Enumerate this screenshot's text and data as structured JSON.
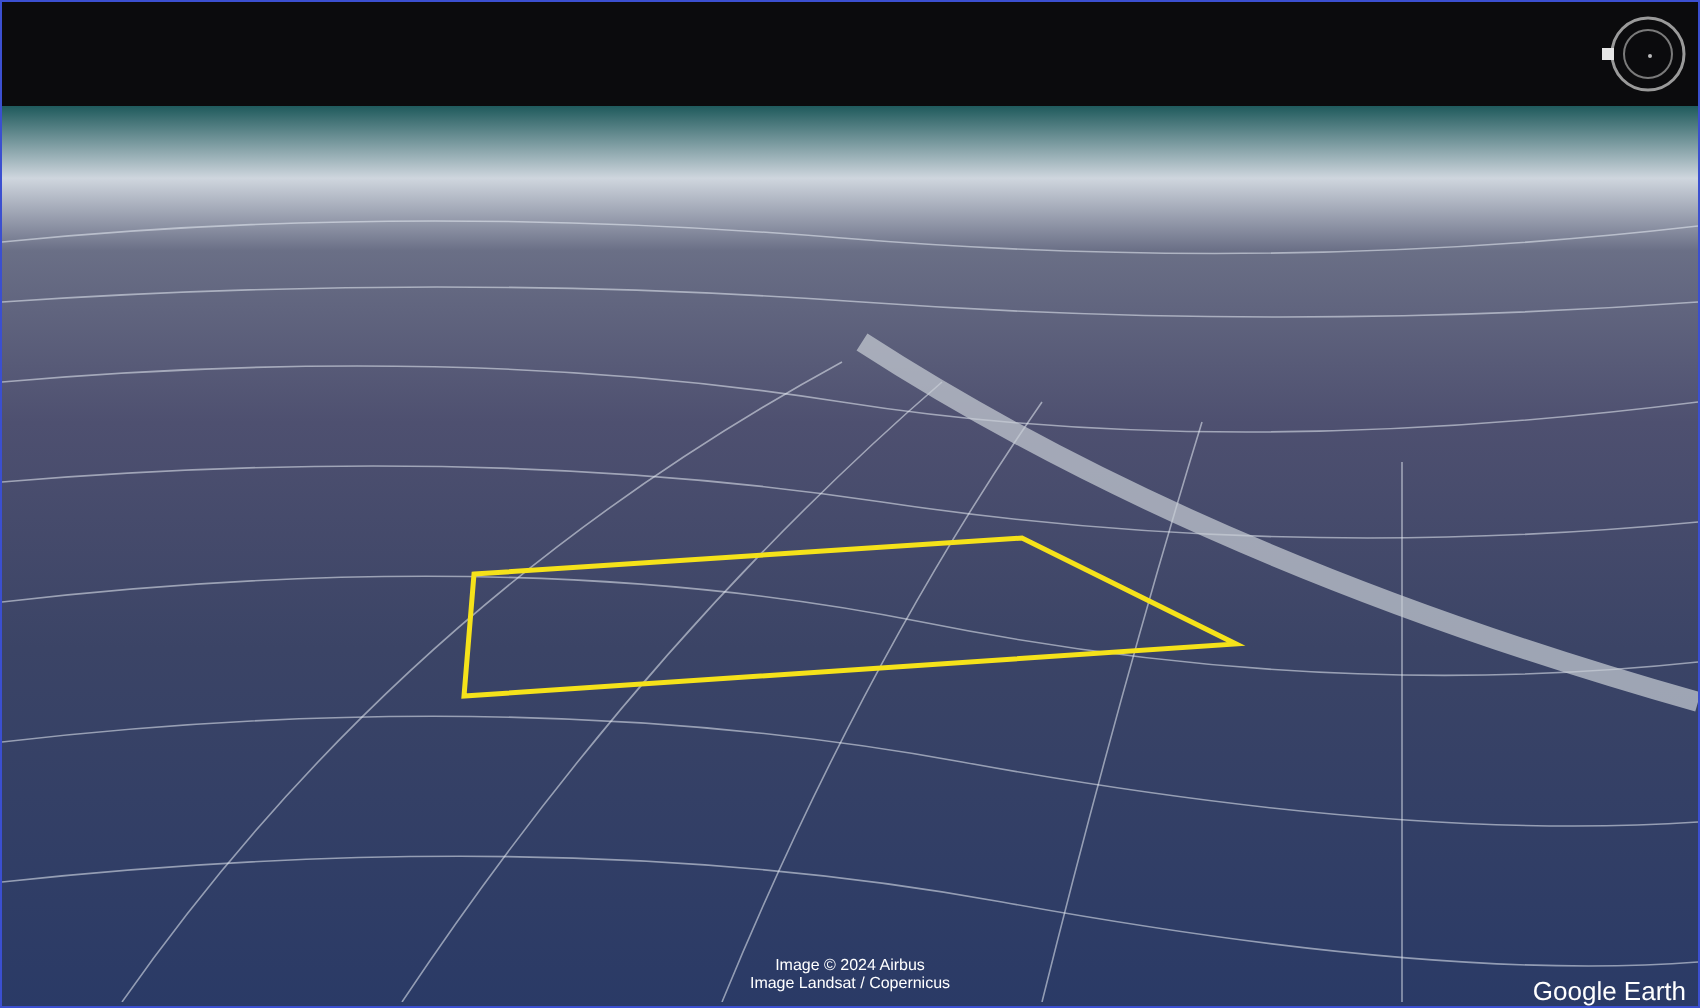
{
  "attribution": [
    "Image © 2024 Airbus",
    "Image Landsat / Copernicus"
  ],
  "logo": "Google Earth"
}
